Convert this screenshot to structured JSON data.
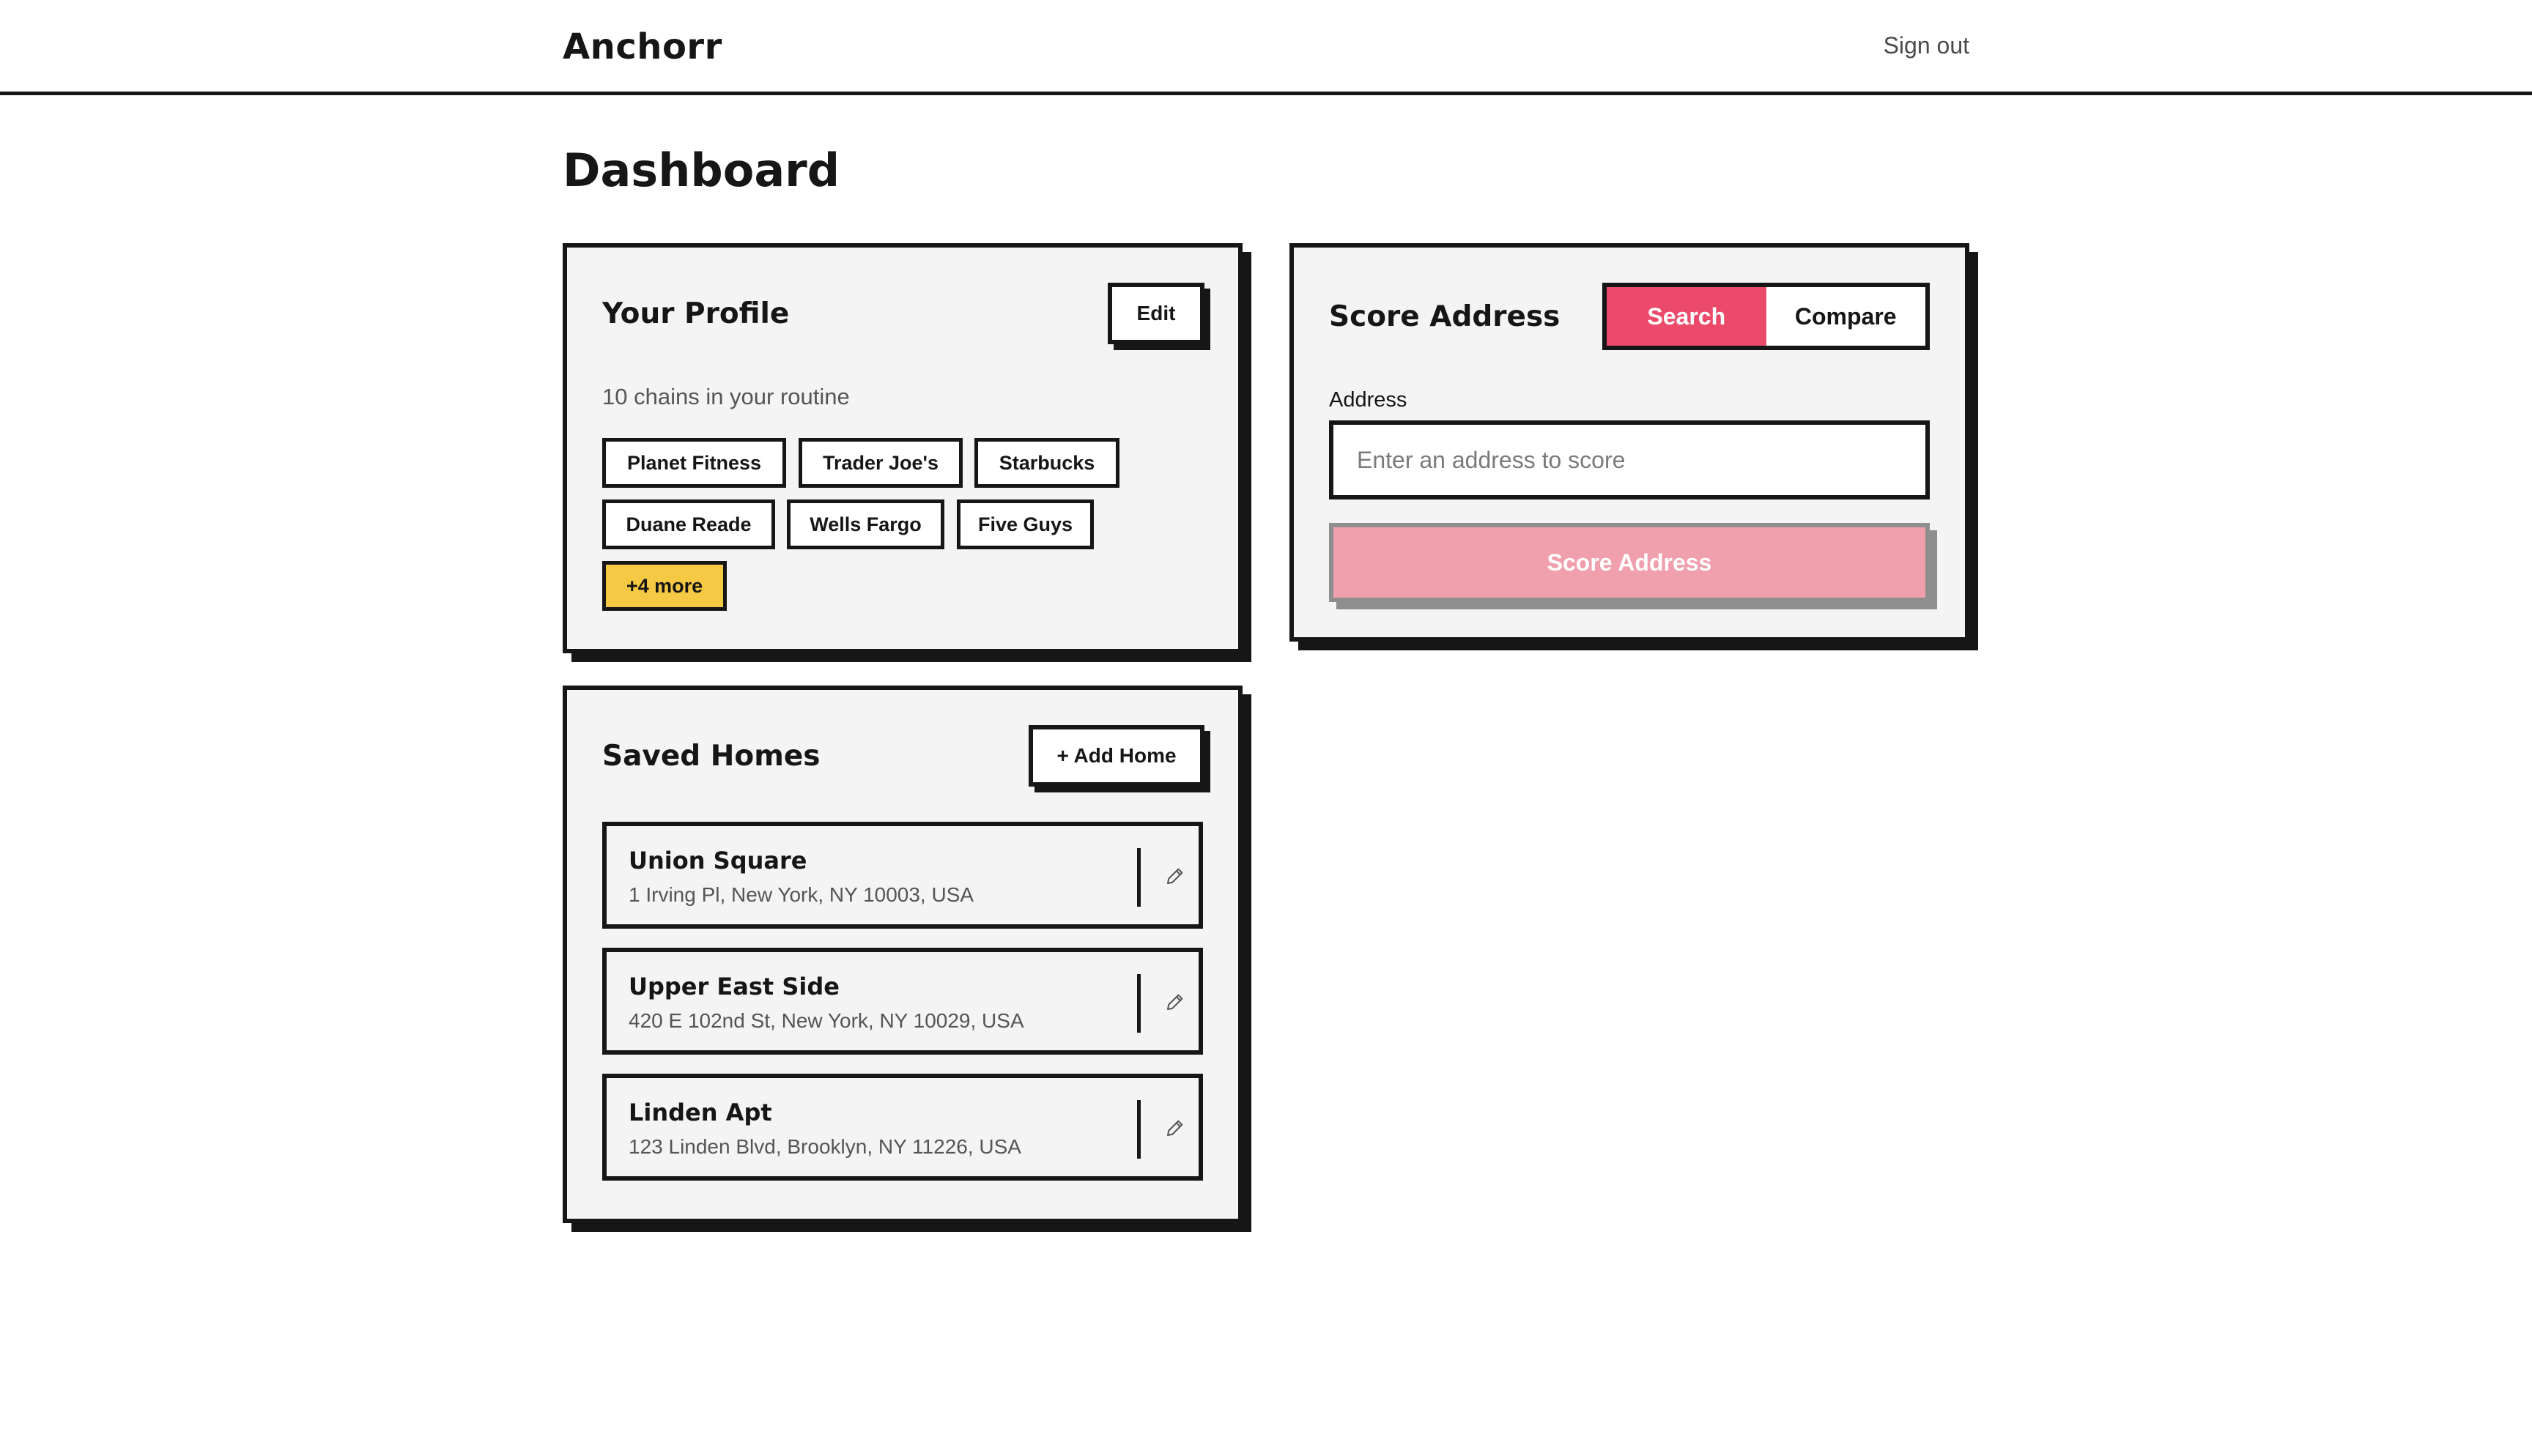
{
  "header": {
    "brand": "Anchorr",
    "sign_out": "Sign out"
  },
  "page": {
    "title": "Dashboard"
  },
  "profile": {
    "title": "Your Profile",
    "edit_label": "Edit",
    "summary": "10 chains in your routine",
    "chains": [
      "Planet Fitness",
      "Trader Joe's",
      "Starbucks",
      "Duane Reade",
      "Wells Fargo",
      "Five Guys"
    ],
    "more_label": "+4 more"
  },
  "score": {
    "title": "Score Address",
    "tabs": [
      {
        "label": "Search",
        "active": true
      },
      {
        "label": "Compare",
        "active": false
      }
    ],
    "address_label": "Address",
    "address_placeholder": "Enter an address to score",
    "address_value": "",
    "submit_label": "Score Address"
  },
  "saved_homes": {
    "title": "Saved Homes",
    "add_label": "+ Add Home",
    "homes": [
      {
        "name": "Union Square",
        "address": "1 Irving Pl, New York, NY 10003, USA"
      },
      {
        "name": "Upper East Side",
        "address": "420 E 102nd St, New York, NY 10029, USA"
      },
      {
        "name": "Linden Apt",
        "address": "123 Linden Blvd, Brooklyn, NY 11226, USA"
      }
    ]
  },
  "colors": {
    "ink": "#161616",
    "card_bg": "#f4f4f4",
    "accent_pink": "#ec4a6a",
    "disabled_pink": "#f09fac",
    "chip_yellow": "#f6c945"
  },
  "icons": {
    "home_edit": "pencil-icon"
  }
}
